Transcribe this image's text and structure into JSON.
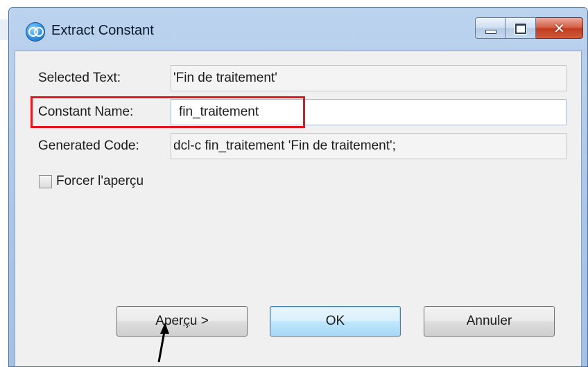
{
  "window": {
    "title": "Extract Constant",
    "icons": {
      "app": "app-icon",
      "minimize": "minimize-icon",
      "maximize": "maximize-icon",
      "close": "close-icon"
    },
    "close_glyph": "✕"
  },
  "form": {
    "selected_text": {
      "label": "Selected Text:",
      "value": "'Fin de traitement'"
    },
    "constant_name": {
      "label": "Constant Name:",
      "value": "fin_traitement"
    },
    "generated_code": {
      "label": "Generated Code:",
      "value": "dcl-c fin_traitement 'Fin de traitement';"
    },
    "force_preview": {
      "label": "Forcer l'aperçu",
      "checked": false
    }
  },
  "buttons": {
    "preview": {
      "label_prefix": "Aper",
      "label_underlined": "ç",
      "label_suffix": "u >"
    },
    "ok": "OK",
    "cancel": "Annuler"
  },
  "annotations": {
    "highlight_color": "#e8141b",
    "arrow_color": "#000000"
  }
}
